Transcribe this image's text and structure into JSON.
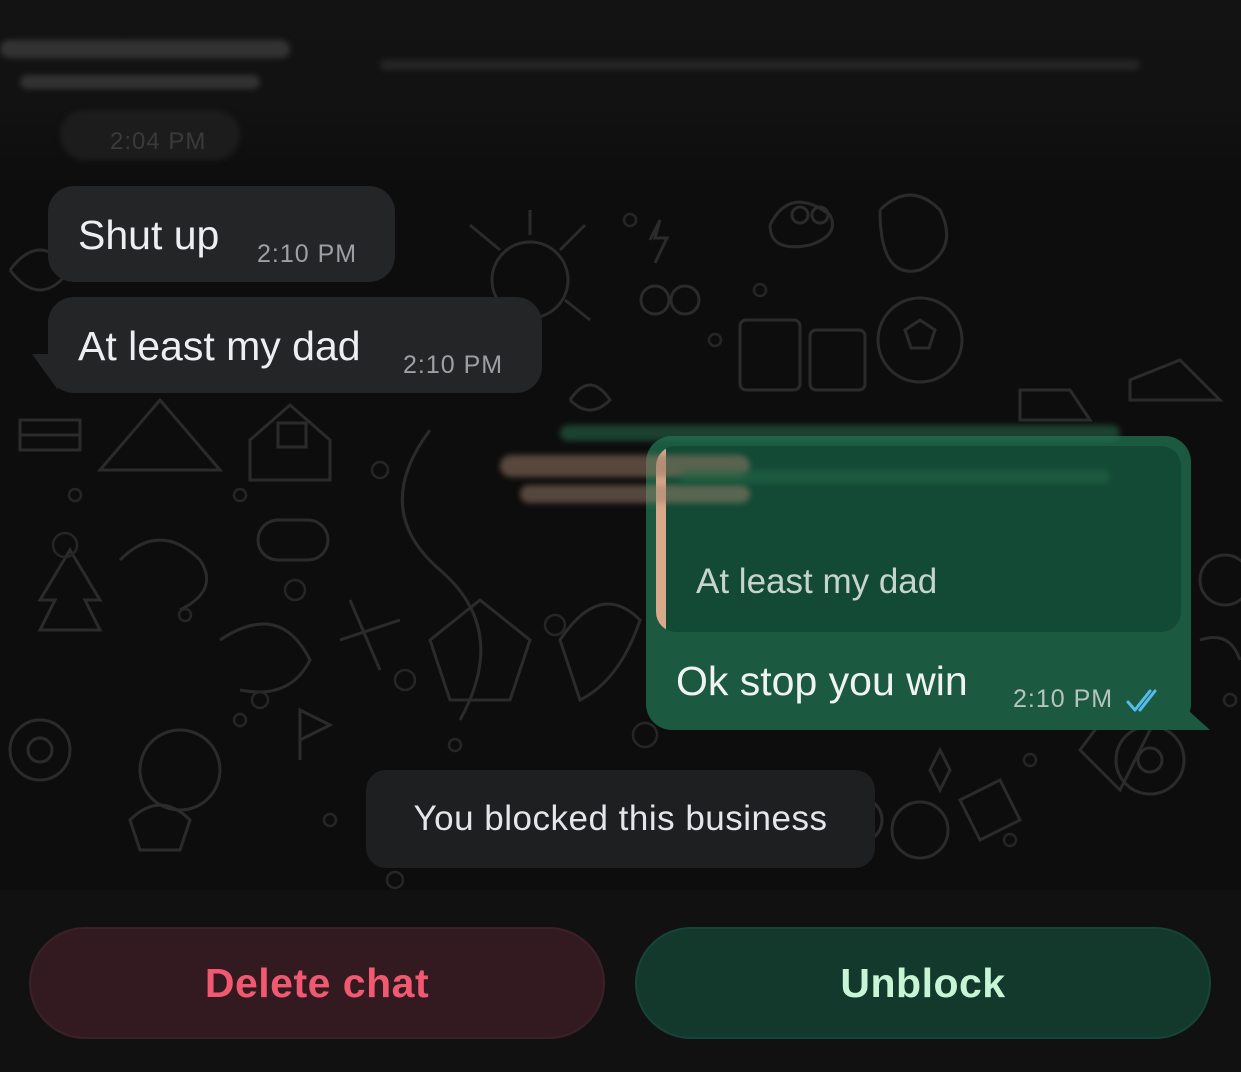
{
  "chat": {
    "previous_time": "2:04 PM",
    "incoming": [
      {
        "text": "Shut up",
        "time": "2:10 PM"
      },
      {
        "text": "At least my dad",
        "time": "2:10 PM"
      }
    ],
    "outgoing": {
      "quoted_text": "At least my dad",
      "text": "Ok stop you win",
      "time": "2:10 PM",
      "status_icon": "double-check-read-icon"
    },
    "system_notice": "You blocked this business"
  },
  "actions": {
    "delete_label": "Delete chat",
    "unblock_label": "Unblock"
  },
  "colors": {
    "background": "#0d0d0d",
    "incoming_bubble": "#242526",
    "outgoing_bubble": "#1b5a41",
    "delete_text": "#f0596f",
    "unblock_text": "#c8f5d6",
    "read_ticks": "#53bdeb"
  }
}
